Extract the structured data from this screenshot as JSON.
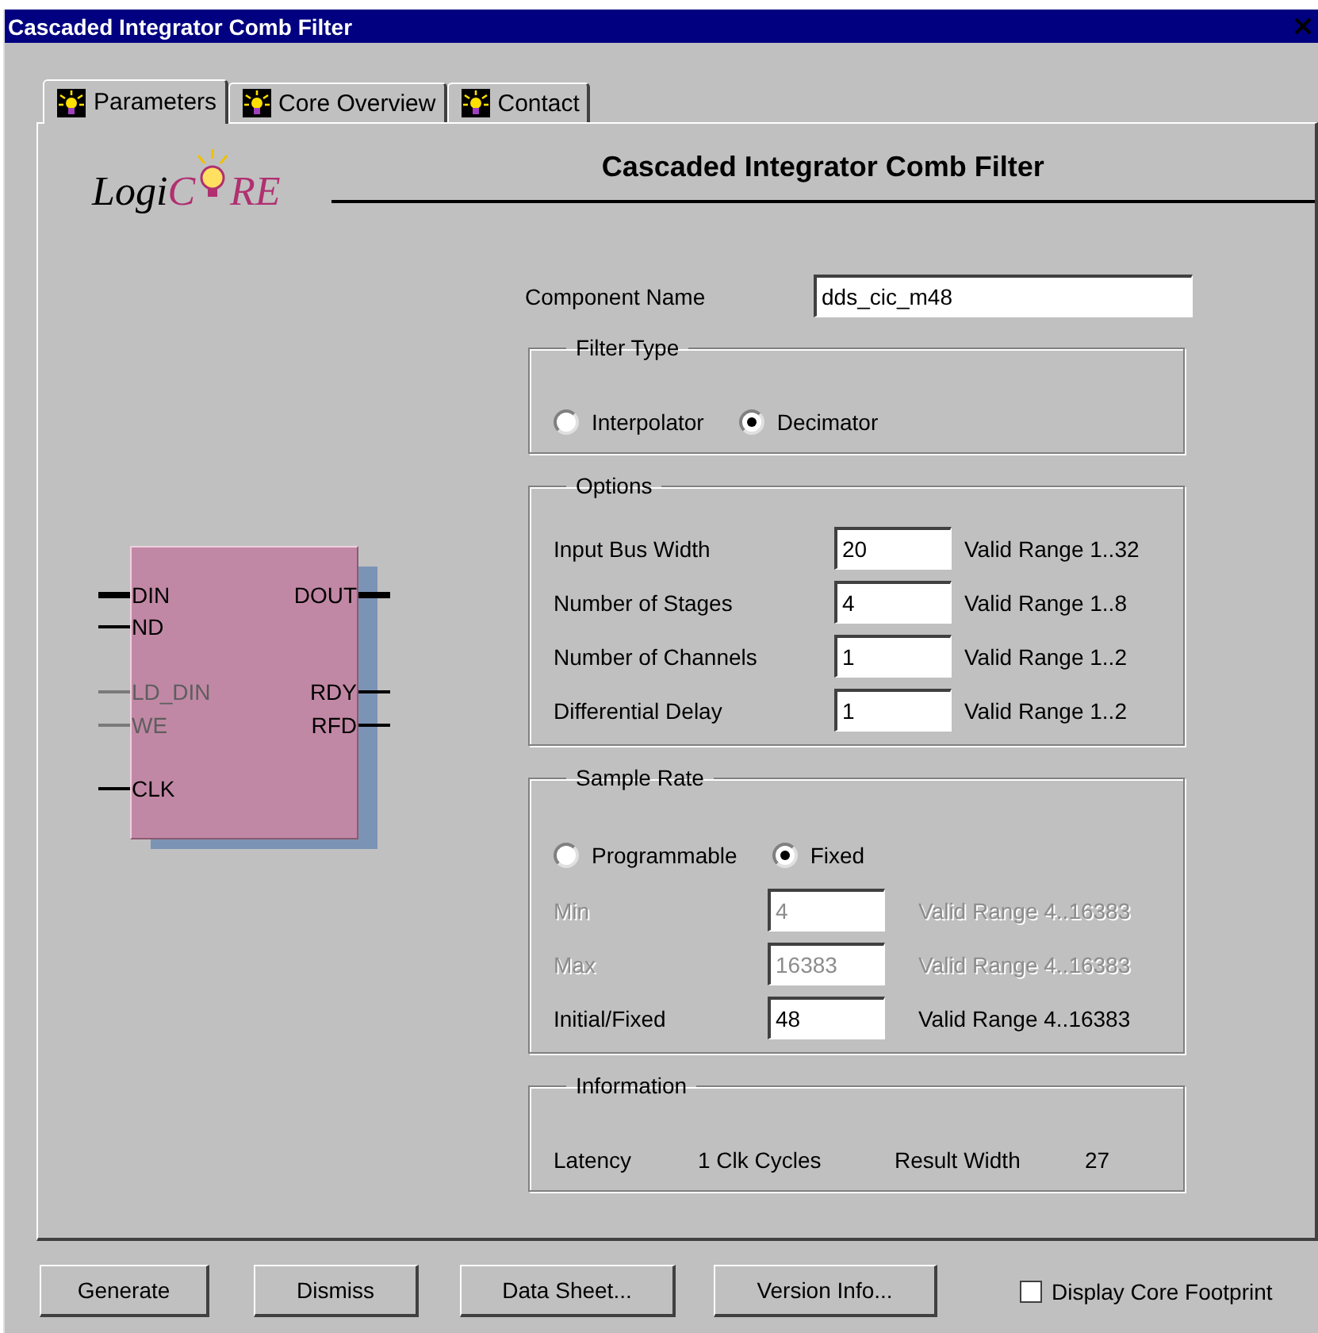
{
  "window": {
    "title": "Cascaded Integrator Comb Filter"
  },
  "tabs": [
    {
      "label": "Parameters",
      "selected": true
    },
    {
      "label": "Core Overview",
      "selected": false
    },
    {
      "label": "Contact",
      "selected": false
    }
  ],
  "logo": {
    "parts": [
      "Logi",
      "C",
      "RE"
    ]
  },
  "heading": "Cascaded Integrator Comb Filter",
  "symbol": {
    "left_pins": [
      {
        "name": "DIN",
        "bus": true,
        "disabled": false
      },
      {
        "name": "ND",
        "bus": false,
        "disabled": false
      },
      {
        "name": "LD_DIN",
        "bus": false,
        "disabled": true
      },
      {
        "name": "WE",
        "bus": false,
        "disabled": true
      },
      {
        "name": "CLK",
        "bus": false,
        "disabled": false
      }
    ],
    "right_pins": [
      {
        "name": "DOUT",
        "bus": true,
        "disabled": false
      },
      {
        "name": "RDY",
        "bus": false,
        "disabled": false
      },
      {
        "name": "RFD",
        "bus": false,
        "disabled": false
      }
    ]
  },
  "component_name": {
    "label": "Component Name",
    "value": "dds_cic_m48"
  },
  "groups": [
    {
      "kind": "options",
      "title": "Filter Type",
      "options": [
        {
          "label": "Interpolator",
          "selected": false
        },
        {
          "label": "Decimator",
          "selected": true
        }
      ]
    },
    {
      "kind": "options",
      "title": "Options",
      "rows": [
        {
          "label": "Input Bus Width",
          "value": "20",
          "range": "Valid Range 1..32",
          "disabled": false
        },
        {
          "label": "Number of Stages",
          "value": "4",
          "range": "Valid Range 1..8",
          "disabled": false
        },
        {
          "label": "Number of Channels",
          "value": "1",
          "range": "Valid Range 1..2",
          "disabled": false
        },
        {
          "label": "Differential Delay",
          "value": "1",
          "range": "Valid Range 1..2",
          "disabled": false
        }
      ]
    },
    {
      "kind": "rate",
      "title": "Sample Rate",
      "options": [
        {
          "label": "Programmable",
          "selected": false
        },
        {
          "label": "Fixed",
          "selected": true
        }
      ],
      "rows": [
        {
          "label": "Min",
          "value": "4",
          "range": "Valid Range 4..16383",
          "disabled": true
        },
        {
          "label": "Max",
          "value": "16383",
          "range": "Valid Range 4..16383",
          "disabled": true
        },
        {
          "label": "Initial/Fixed",
          "value": "48",
          "range": "Valid Range 4..16383",
          "disabled": false
        }
      ]
    },
    {
      "kind": "options",
      "title": "Information",
      "info": [
        "Latency",
        "1 Clk Cycles",
        "Result Width",
        "27"
      ]
    }
  ],
  "buttons": [
    "Generate",
    "Dismiss",
    "Data Sheet...",
    "Version Info..."
  ],
  "footprint": {
    "label": "Display Core Footprint",
    "checked": false
  }
}
